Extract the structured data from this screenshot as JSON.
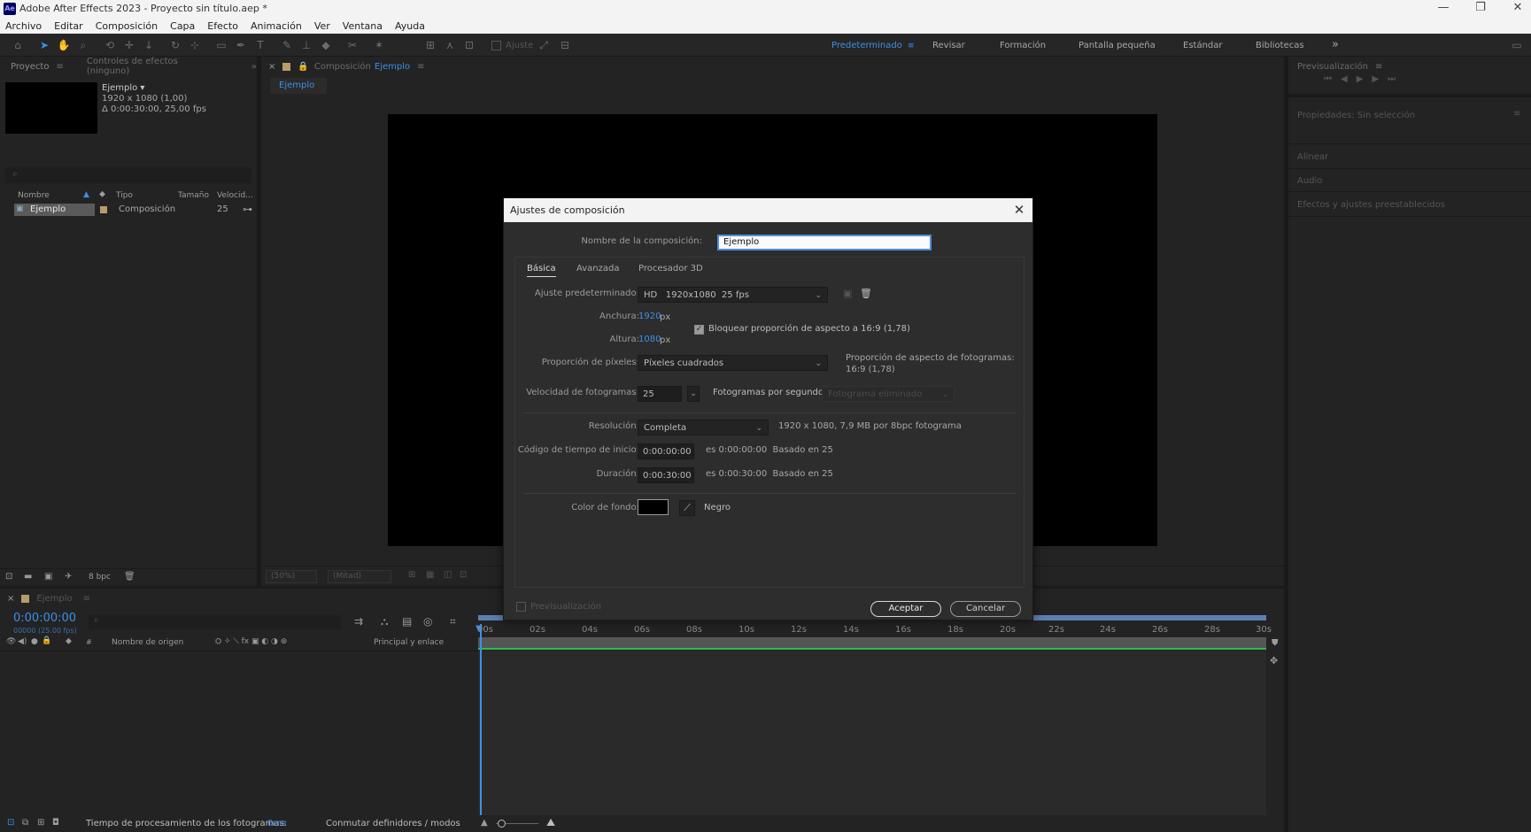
{
  "window": {
    "app_icon": "Ae",
    "title": "Adobe After Effects 2023 - Proyecto sin título.aep *",
    "controls": [
      "—",
      "❐",
      "✕"
    ]
  },
  "menu": [
    "Archivo",
    "Editar",
    "Composición",
    "Capa",
    "Efecto",
    "Animación",
    "Ver",
    "Ventana",
    "Ayuda"
  ],
  "toolbar": {
    "align_label": "Ajuste",
    "workspaces": [
      "Predeterminado",
      "Revisar",
      "Formación",
      "Pantalla pequeña",
      "Estándar",
      "Bibliotecas"
    ],
    "active_workspace": "Predeterminado",
    "more": "»"
  },
  "project_panel": {
    "tab": "Proyecto",
    "effects_tab": "Controles de efectos (ninguno)",
    "item_name": "Ejemplo ▾",
    "item_dims": "1920 x 1080 (1,00)",
    "item_duration": "Δ 0:00:30:00, 25,00 fps",
    "columns": [
      "Nombre",
      "Tipo",
      "Tamaño",
      "Velocid..."
    ],
    "row": {
      "name": "Ejemplo",
      "type": "Composición",
      "speed": "25"
    },
    "bpc": "8 bpc"
  },
  "viewer": {
    "tab_prefix": "Composición",
    "tab_name": "Ejemplo",
    "subtab": "Ejemplo",
    "zoom": "(50%)",
    "resolution": "(Mitad)"
  },
  "right_panel": {
    "preview": "Previsualización",
    "properties": "Propiedades: Sin selección",
    "align": "Alinear",
    "audio": "Audio",
    "effects": "Efectos y ajustes preestablecidos"
  },
  "timeline": {
    "tab": "Ejemplo",
    "timecode": "0:00:00:00",
    "frames": "00000 (25.00 fps)",
    "col_source": "Nombre de origen",
    "col_parent": "Principal y enlace",
    "ticks": [
      "00s",
      "02s",
      "04s",
      "06s",
      "08s",
      "10s",
      "12s",
      "14s",
      "16s",
      "18s",
      "20s",
      "22s",
      "24s",
      "26s",
      "28s",
      "30s"
    ]
  },
  "status": {
    "render_label": "Tiempo de procesamiento de los fotogramas:",
    "render_value": "0ms",
    "toggle": "Conmutar definidores / modos"
  },
  "dialog": {
    "title": "Ajustes de composición",
    "name_label": "Nombre de la composición:",
    "name_value": "Ejemplo",
    "tabs": [
      "Básica",
      "Avanzada",
      "Procesador 3D"
    ],
    "preset_label": "Ajuste predeterminado:",
    "preset_value": "HD   1920x1080  25 fps",
    "width_label": "Anchura:",
    "width_value": "1920",
    "height_label": "Altura:",
    "height_value": "1080",
    "px": "px",
    "lock_label": "Bloquear proporción de aspecto a 16:9 (1,78)",
    "lock_checked": true,
    "par_label": "Proporción de píxeles:",
    "par_value": "Píxeles cuadrados",
    "frame_aspect_label": "Proporción de aspecto de fotogramas:",
    "frame_aspect_value": "16:9 (1,78)",
    "fps_label": "Velocidad de fotogramas:",
    "fps_value": "25",
    "fps_unit": "Fotogramas por segundo",
    "drop_frame": "Fotograma eliminado",
    "res_label": "Resolución:",
    "res_value": "Completa",
    "res_info": "1920 x 1080, 7,9 MB por 8bpc fotograma",
    "start_label": "Código de tiempo de inicio:",
    "start_value": "0:00:00:00",
    "start_info": "es 0:00:00:00  Basado en 25",
    "dur_label": "Duración:",
    "dur_value": "0:00:30:00",
    "dur_info": "es 0:00:30:00  Basado en 25",
    "bg_label": "Color de fondo:",
    "bg_name": "Negro",
    "bg_color": "#000000",
    "preview_label": "Previsualización",
    "ok": "Aceptar",
    "cancel": "Cancelar"
  }
}
